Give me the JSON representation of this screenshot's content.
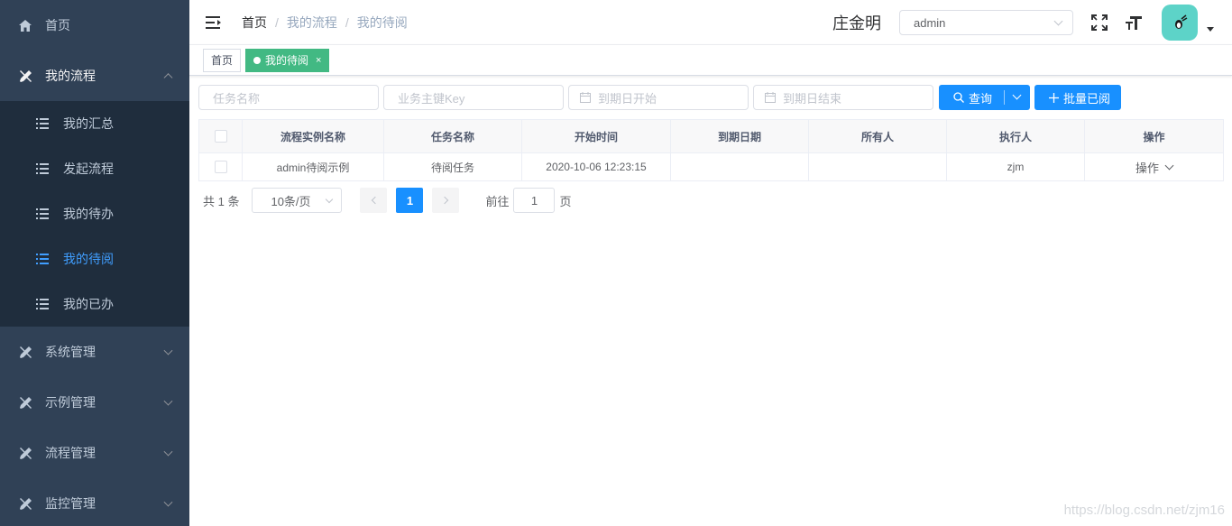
{
  "sidebar": {
    "items": [
      {
        "label": "首页",
        "icon": "home-icon"
      },
      {
        "label": "我的流程",
        "icon": "tools-icon",
        "open": true
      },
      {
        "label": "系统管理",
        "icon": "tools-icon"
      },
      {
        "label": "示例管理",
        "icon": "tools-icon"
      },
      {
        "label": "流程管理",
        "icon": "tools-icon"
      },
      {
        "label": "监控管理",
        "icon": "tools-icon"
      }
    ],
    "submenu": [
      {
        "label": "我的汇总"
      },
      {
        "label": "发起流程"
      },
      {
        "label": "我的待办"
      },
      {
        "label": "我的待阅",
        "active": true
      },
      {
        "label": "我的已办"
      }
    ]
  },
  "header": {
    "breadcrumb": [
      "首页",
      "我的流程",
      "我的待阅"
    ],
    "username": "庄金明",
    "role": "admin"
  },
  "tags": [
    {
      "label": "首页"
    },
    {
      "label": "我的待阅",
      "close": "×",
      "active": true
    }
  ],
  "filters": {
    "task_name_placeholder": "任务名称",
    "business_key_placeholder": "业务主键Key",
    "due_start_placeholder": "到期日开始",
    "due_end_placeholder": "到期日结束",
    "query_label": "查询",
    "batch_label": "批量已阅"
  },
  "table": {
    "columns": [
      "流程实例名称",
      "任务名称",
      "开始时间",
      "到期日期",
      "所有人",
      "执行人",
      "操作"
    ],
    "rows": [
      {
        "instance": "admin待阅示例",
        "task": "待阅任务",
        "start": "2020-10-06 12:23:15",
        "due": "",
        "owner": "",
        "assignee": "zjm",
        "action": "操作"
      }
    ]
  },
  "pagination": {
    "total": "共 1 条",
    "page_size": "10条/页",
    "current": "1",
    "goto_label": "前往",
    "goto_value": "1",
    "page_suffix": "页"
  },
  "watermark": "https://blog.csdn.net/zjm16",
  "colors": {
    "sidebar": "#304156",
    "submenu": "#1f2d3d",
    "primary": "#1890ff",
    "tag_active": "#42b983",
    "avatar": "#5dd3c8"
  }
}
